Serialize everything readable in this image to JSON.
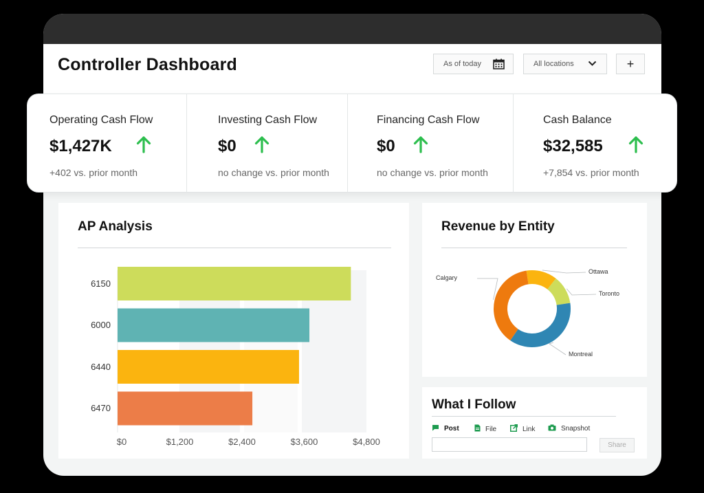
{
  "header": {
    "title": "Controller Dashboard",
    "date_filter": "As of today",
    "location_filter": "All locations",
    "add_label": "+"
  },
  "kpis": [
    {
      "label": "Operating Cash Flow",
      "value": "$1,427K",
      "sub": "+402 vs. prior month",
      "trend": "up"
    },
    {
      "label": "Investing Cash Flow",
      "value": "$0",
      "sub": "no change vs. prior month",
      "trend": "up"
    },
    {
      "label": "Financing Cash Flow",
      "value": "$0",
      "sub": "no change vs. prior month",
      "trend": "up"
    },
    {
      "label": "Cash Balance",
      "value": "$32,585",
      "sub": "+7,854 vs. prior month",
      "trend": "up"
    }
  ],
  "colors": {
    "trend_up": "#2dbe4e",
    "bar_lime": "#cddc5b",
    "bar_teal": "#5fb3b3",
    "bar_amber": "#fbb40f",
    "bar_coral": "#ec7d48",
    "donut_orange": "#ee7a0e",
    "donut_blue": "#2f86b3"
  },
  "ap_analysis": {
    "title": "AP Analysis"
  },
  "revenue": {
    "title": "Revenue by Entity"
  },
  "chart_data": [
    {
      "type": "bar",
      "orientation": "horizontal",
      "title": "AP Analysis",
      "categories": [
        "6150",
        "6000",
        "6440",
        "6470"
      ],
      "values": [
        4500,
        3700,
        3500,
        2600
      ],
      "x_ticks": [
        "$0",
        "$1,200",
        "$2,400",
        "$3,600",
        "$4,800"
      ],
      "xlim": [
        0,
        4800
      ],
      "bar_colors": [
        "#cddc5b",
        "#5fb3b3",
        "#fbb40f",
        "#ec7d48"
      ]
    },
    {
      "type": "pie",
      "style": "donut",
      "title": "Revenue by Entity",
      "labels": [
        "Ottawa",
        "Toronto",
        "Montreal",
        "Calgary"
      ],
      "values": [
        13,
        12,
        37,
        38
      ],
      "colors": [
        "#fbb40f",
        "#cddc5b",
        "#2f86b3",
        "#ee7a0e"
      ]
    }
  ],
  "follow": {
    "title": "What I Follow",
    "tabs": [
      {
        "label": "Post",
        "icon": "comment-icon"
      },
      {
        "label": "File",
        "icon": "file-icon"
      },
      {
        "label": "Link",
        "icon": "link-icon"
      },
      {
        "label": "Snapshot",
        "icon": "camera-icon"
      }
    ],
    "share_label": "Share"
  }
}
